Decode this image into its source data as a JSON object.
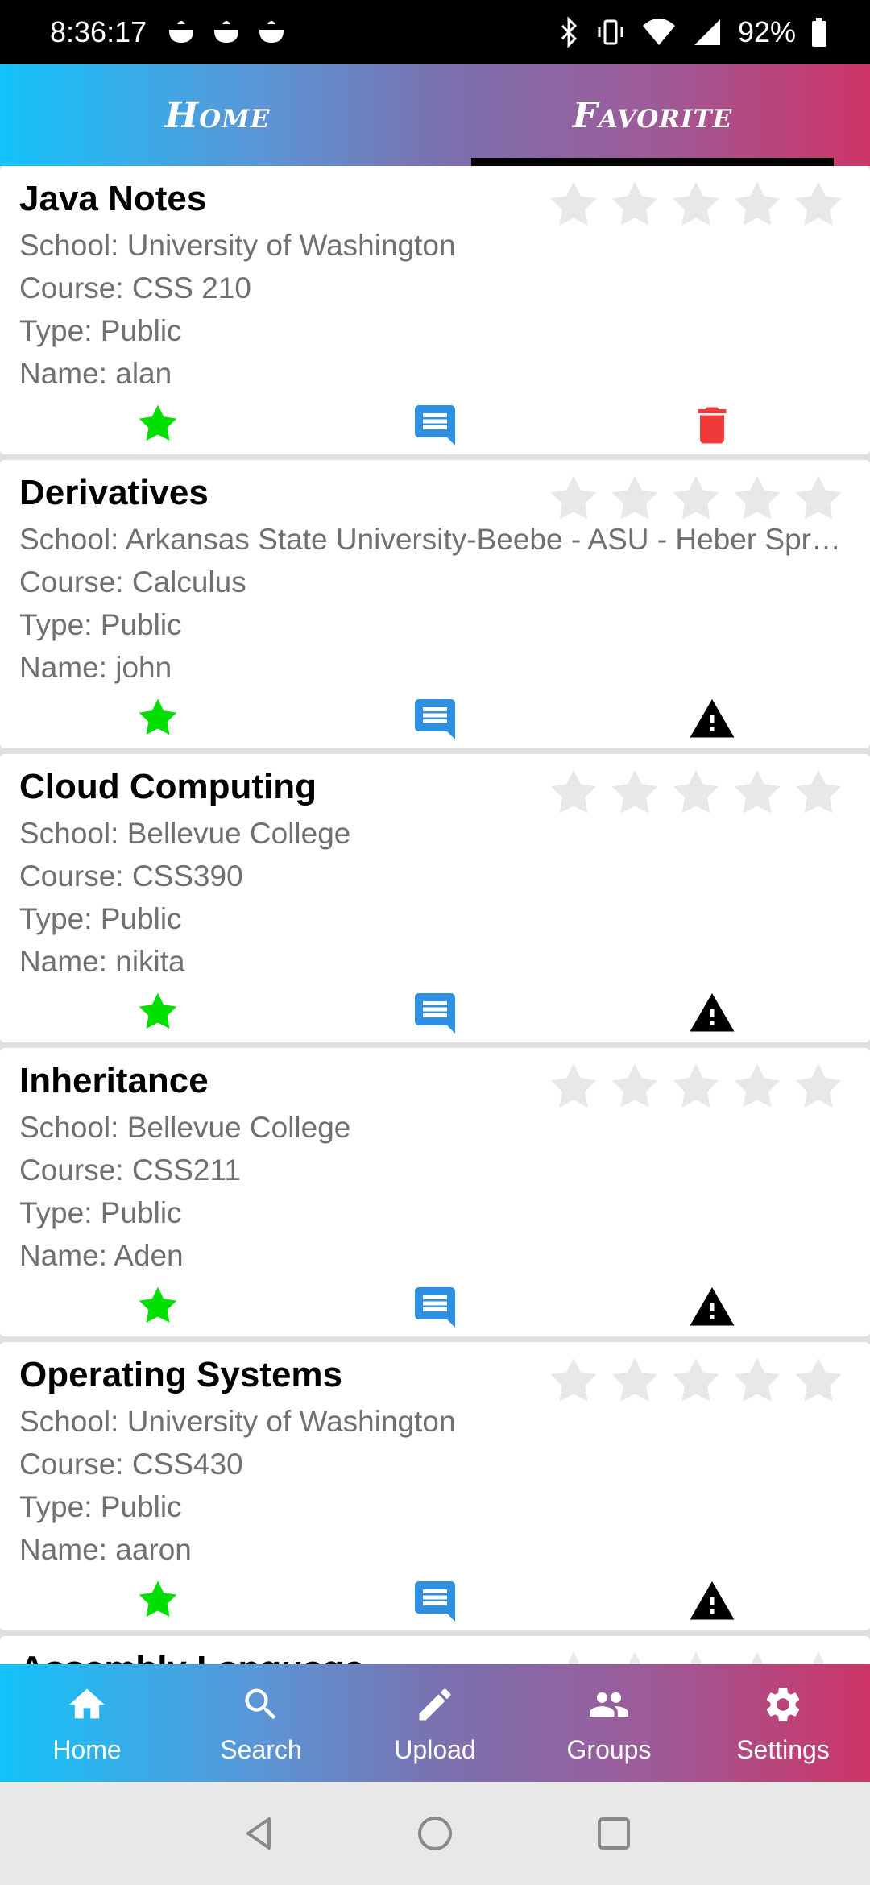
{
  "status_bar": {
    "time": "8:36:17",
    "battery": "92%"
  },
  "tabs": [
    {
      "label": "Home",
      "selected": false
    },
    {
      "label": "Favorite",
      "selected": true
    }
  ],
  "notes": [
    {
      "title": "Java Notes",
      "school": "School: University of Washington",
      "course": "Course: CSS 210",
      "type": "Type: Public",
      "name": "Name: alan",
      "rating": 0,
      "action_icon": "trash-icon"
    },
    {
      "title": "Derivatives",
      "school": "School: Arkansas State University-Beebe - ASU - Heber Spr…",
      "course": "Course: Calculus",
      "type": "Type: Public",
      "name": "Name: john",
      "rating": 0,
      "action_icon": "warning-icon"
    },
    {
      "title": "Cloud Computing",
      "school": "School: Bellevue College",
      "course": "Course: CSS390",
      "type": "Type: Public",
      "name": "Name: nikita",
      "rating": 0,
      "action_icon": "warning-icon"
    },
    {
      "title": "Inheritance",
      "school": "School: Bellevue College",
      "course": "Course: CSS211",
      "type": "Type: Public",
      "name": "Name: Aden",
      "rating": 0,
      "action_icon": "warning-icon"
    },
    {
      "title": "Operating Systems",
      "school": "School: University of Washington",
      "course": "Course: CSS430",
      "type": "Type: Public",
      "name": "Name: aaron",
      "rating": 0,
      "action_icon": "warning-icon"
    },
    {
      "title": "Assembly Language",
      "partial": true
    }
  ],
  "bottom_nav": [
    {
      "label": "Home",
      "icon": "home-icon"
    },
    {
      "label": "Search",
      "icon": "search-icon"
    },
    {
      "label": "Upload",
      "icon": "pencil-icon"
    },
    {
      "label": "Groups",
      "icon": "groups-icon"
    },
    {
      "label": "Settings",
      "icon": "gear-icon"
    }
  ],
  "colors": {
    "favorite": "#00e000",
    "comment": "#2f8fe0",
    "trash": "#f03a3a",
    "star_empty": "#e8e8e8"
  }
}
